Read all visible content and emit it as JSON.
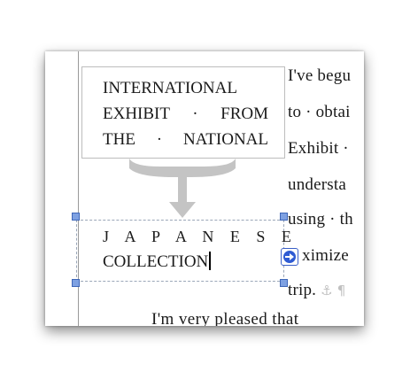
{
  "document": {
    "callout_lines": [
      "INTERNATIONAL",
      "EXHIBIT · FROM",
      "THE · NATIONAL"
    ],
    "textbox_lines": [
      "J A P A N E S E",
      "COLLECTION"
    ],
    "body_lines": [
      "I've begu",
      "to · obtai",
      "Exhibit ·",
      "understa",
      "using · th",
      "ximize",
      "trip."
    ],
    "bottom_line": "I'm very pleased that",
    "formatting_marks": {
      "anchor": "⚓",
      "pilcrow": "¶"
    }
  },
  "colors": {
    "connector": "#c4c4c4",
    "handle_fill": "#7ea1e2",
    "handle_border": "#3f67b8",
    "link_arrow": "#2f5bd3"
  },
  "icons": {
    "link_arrow": "text-flow-arrow-icon",
    "anchor": "anchor-icon",
    "pilcrow": "pilcrow-icon"
  }
}
